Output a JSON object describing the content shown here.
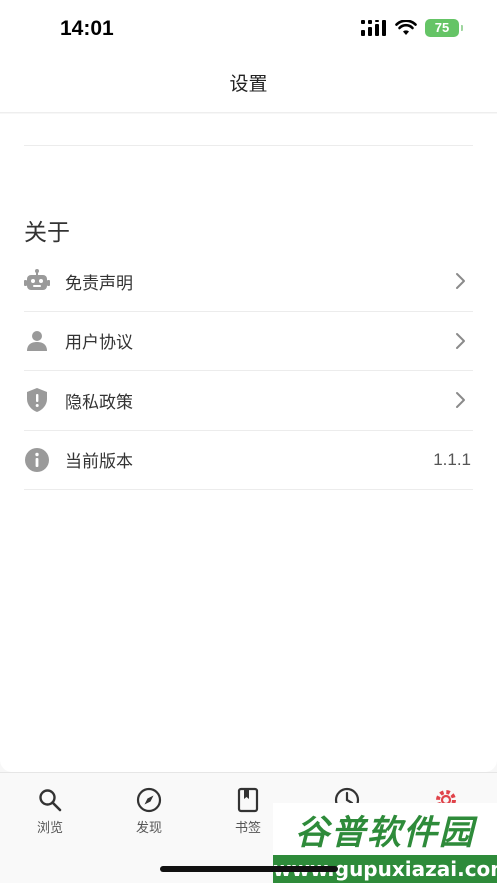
{
  "status_bar": {
    "time": "14:01",
    "battery": "75"
  },
  "nav": {
    "title": "设置"
  },
  "about": {
    "section_title": "关于",
    "items": [
      {
        "label": "免责声明",
        "icon": "robot-icon",
        "trailing": "chevron"
      },
      {
        "label": "用户协议",
        "icon": "person-icon",
        "trailing": "chevron"
      },
      {
        "label": "隐私政策",
        "icon": "shield-icon",
        "trailing": "chevron"
      },
      {
        "label": "当前版本",
        "icon": "info-icon",
        "trailing": "value",
        "value": "1.1.1"
      }
    ]
  },
  "tab_bar": {
    "tabs": [
      {
        "label": "浏览",
        "icon": "search-icon"
      },
      {
        "label": "发现",
        "icon": "compass-icon"
      },
      {
        "label": "书签",
        "icon": "book-icon"
      },
      {
        "label": "",
        "icon": "clock-icon"
      },
      {
        "label": "",
        "icon": "gear-icon"
      }
    ]
  },
  "watermark": {
    "title": "谷普软件园",
    "url": "www.gupuxiazai.com"
  },
  "colors": {
    "icon_gray": "#9a9a9a",
    "battery_green": "#65c466",
    "watermark_green": "#2e8b3a",
    "active_tab_red": "#e0434a"
  }
}
